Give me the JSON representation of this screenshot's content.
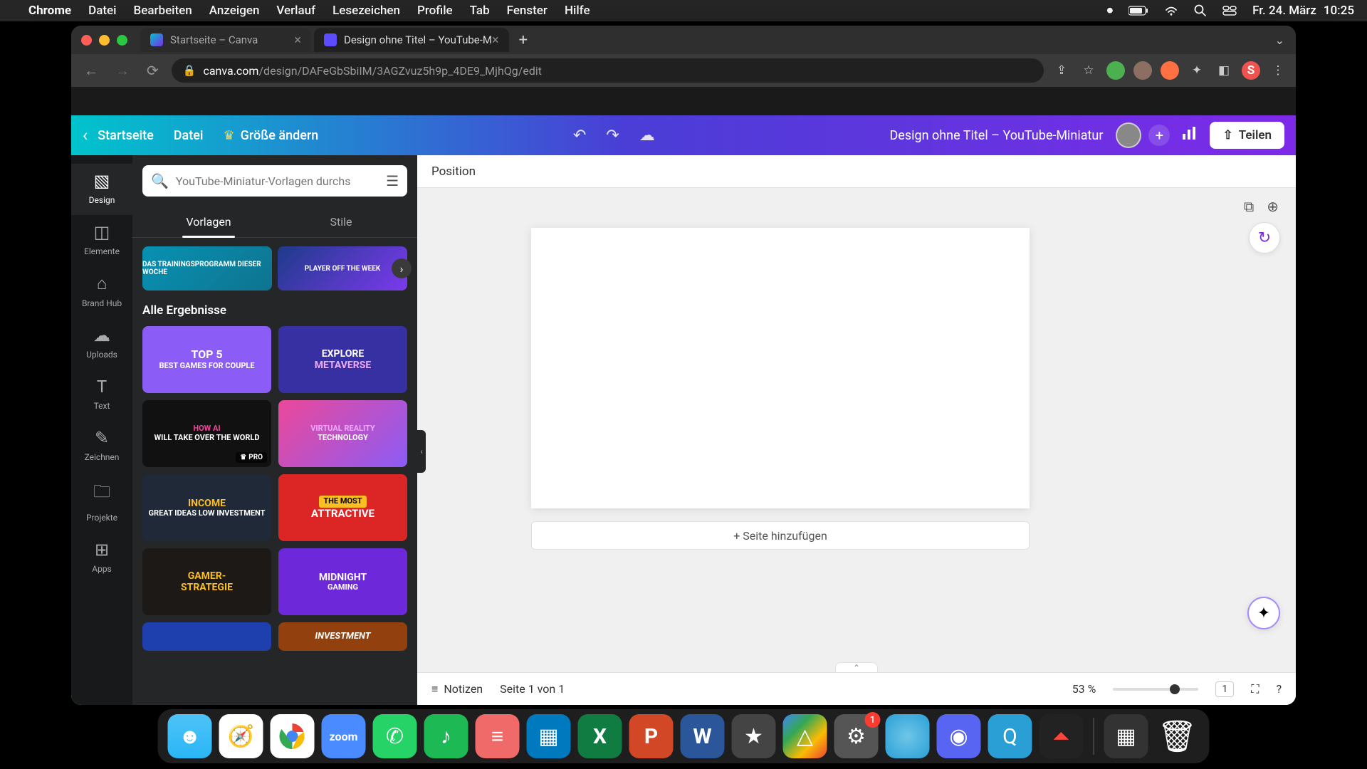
{
  "menubar": {
    "app": "Chrome",
    "items": [
      "Datei",
      "Bearbeiten",
      "Anzeigen",
      "Verlauf",
      "Lesezeichen",
      "Profile",
      "Tab",
      "Fenster",
      "Hilfe"
    ],
    "date": "Fr. 24. März",
    "time": "10:25"
  },
  "tabs": {
    "t1": "Startseite – Canva",
    "t2": "Design ohne Titel – YouTube-M"
  },
  "url": {
    "domain": "canva.com",
    "path": "/design/DAFeGbSbiIM/3AGZvuz5h9p_4DE9_MjhQg/edit"
  },
  "header": {
    "home": "Startseite",
    "file": "Datei",
    "resize": "Größe ändern",
    "title": "Design ohne Titel – YouTube-Miniatur",
    "share": "Teilen"
  },
  "rail": {
    "design": "Design",
    "elements": "Elemente",
    "brandhub": "Brand Hub",
    "uploads": "Uploads",
    "text": "Text",
    "draw": "Zeichnen",
    "projects": "Projekte",
    "apps": "Apps"
  },
  "panel": {
    "search_placeholder": "YouTube-Miniatur-Vorlagen durchs",
    "tab_templates": "Vorlagen",
    "tab_styles": "Stile",
    "section_all": "Alle Ergebnisse",
    "featured": [
      {
        "label": "DAS TRAININGSPROGRAMM DIESER WOCHE",
        "bg": "linear-gradient(135deg,#0891b2,#0e7490)"
      },
      {
        "label": "PLAYER OFF THE WEEK",
        "bg": "linear-gradient(135deg,#1e3a8a,#7c3aed)"
      }
    ],
    "thumbs": [
      {
        "line1": "TOP 5",
        "line2": "BEST GAMES FOR COUPLE",
        "bg": "#8b5cf6",
        "accent": "#ff6b9d"
      },
      {
        "line1": "EXPLORE",
        "line2": "METAVERSE",
        "bg": "#3730a3"
      },
      {
        "line1": "HOW AI",
        "line2": "WILL TAKE OVER THE WORLD",
        "bg": "#111",
        "pro": "PRO"
      },
      {
        "line1": "VIRTUAL REALITY",
        "line2": "TECHNOLOGY",
        "bg": "linear-gradient(135deg,#ec4899,#8b5cf6)"
      },
      {
        "line1": "INCOME",
        "line2": "GREAT IDEAS LOW INVESTMENT",
        "bg": "#1f2937"
      },
      {
        "line1": "THE MOST",
        "line2": "ATTRACTIVE",
        "bg": "#dc2626"
      },
      {
        "line1": "GAMER-",
        "line2": "STRATEGIE",
        "bg": "#1c1917"
      },
      {
        "line1": "MIDNIGHT",
        "line2": "GAMING",
        "bg": "#6d28d9"
      },
      {
        "line1": "",
        "line2": "",
        "bg": "#1e40af"
      },
      {
        "line1": "",
        "line2": "INVESTMENT",
        "bg": "#92400e"
      }
    ]
  },
  "canvas": {
    "position": "Position",
    "addpage": "+ Seite hinzufügen"
  },
  "footer": {
    "notes": "Notizen",
    "pageinfo": "Seite 1 von 1",
    "zoom": "53 %",
    "pages": "1"
  },
  "dock": {
    "badge_settings": "1"
  }
}
